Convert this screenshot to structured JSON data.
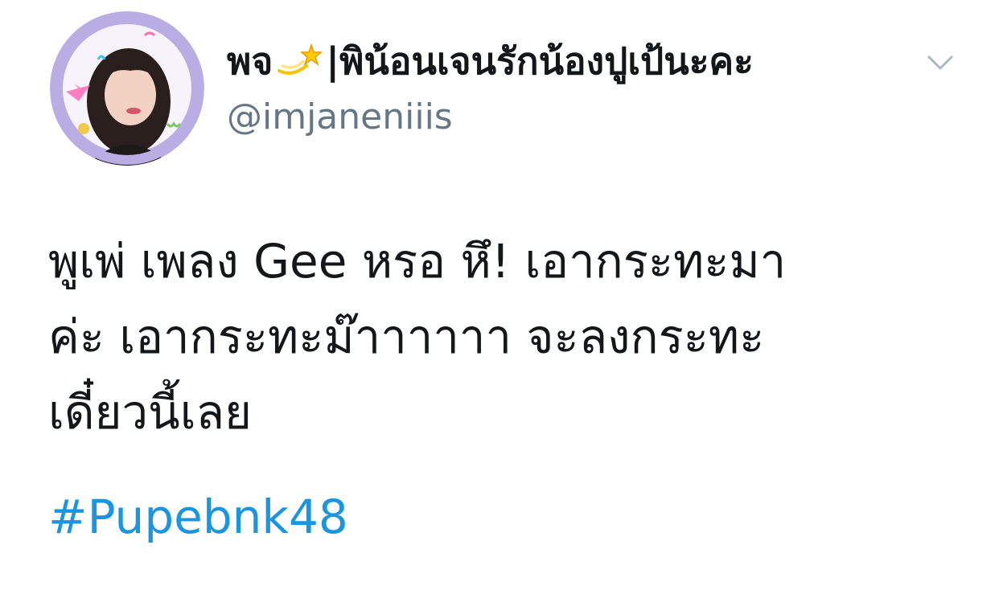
{
  "user": {
    "display_name_prefix": "พจ",
    "display_name_emoji": "dizzy-star-emoji",
    "display_name_suffix": "|พิน้อนเจนรักน้องปูเป้นะคะ",
    "handle": "@imjaneniiis",
    "avatar_badge_text": "#PUPEBNK48"
  },
  "menu": {
    "icon": "chevron-down-icon"
  },
  "tweet": {
    "lines": [
      "พูเพ่ เพลง Gee หรอ หึ! เอากระทะมา",
      "ค่ะ เอากระทะม๊าาาาาา จะลงกระทะ",
      "เดี๋ยวนี้เลย"
    ],
    "hashtag": "#Pupebnk48"
  },
  "colors": {
    "text": "#14171a",
    "secondary": "#657786",
    "link": "#1b95e0",
    "avatar_ring": "#b9aee3"
  }
}
